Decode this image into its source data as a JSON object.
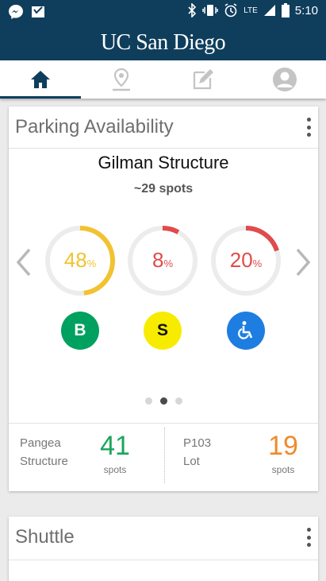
{
  "status": {
    "time": "5:10",
    "network": "LTE"
  },
  "app": {
    "title": "UC San Diego"
  },
  "tabs": [
    {
      "name": "home",
      "icon": "home-icon",
      "active": true
    },
    {
      "name": "map",
      "icon": "map-pin-icon",
      "active": false
    },
    {
      "name": "edit",
      "icon": "edit-icon",
      "active": false
    },
    {
      "name": "profile",
      "icon": "profile-icon",
      "active": false
    }
  ],
  "parking": {
    "title": "Parking Availability",
    "structure": "Gilman Structure",
    "spots": "~29 spots",
    "gauges": [
      {
        "type": "B",
        "value": 48,
        "value_label": "48",
        "color": "#f2c230",
        "badge_color": "#00a060",
        "badge_text_color": "#ffffff"
      },
      {
        "type": "S",
        "value": 8,
        "value_label": "8",
        "color": "#e04b4b",
        "badge_color": "#f7ec00",
        "badge_text_color": "#111111"
      },
      {
        "type": "accessible",
        "value": 20,
        "value_label": "20",
        "color": "#e04b4b",
        "badge_color": "#1e7de0",
        "badge_text_color": "#ffffff"
      }
    ],
    "percent_symbol": "%",
    "page_dots": {
      "count": 3,
      "active": 1
    },
    "summary": [
      {
        "name_line1": "Pangea",
        "name_line2": "Structure",
        "count": "41",
        "unit": "spots",
        "color": "#1aa55c"
      },
      {
        "name_line1": "P103",
        "name_line2": "Lot",
        "count": "19",
        "unit": "spots",
        "color": "#f08a2a"
      }
    ]
  },
  "shuttle": {
    "title": "Shuttle"
  }
}
